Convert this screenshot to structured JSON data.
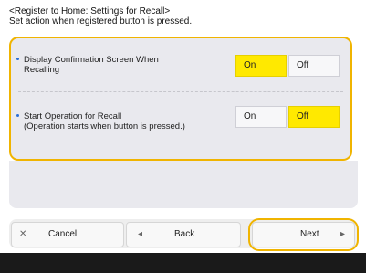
{
  "header": {
    "title": "<Register to Home: Settings for Recall>",
    "subtitle": "Set action when registered button is pressed."
  },
  "settings": [
    {
      "label_line1": "Display Confirmation Screen When",
      "label_line2": "Recalling",
      "options": [
        "On",
        "Off"
      ],
      "selected": "On"
    },
    {
      "label_line1": "Start Operation for Recall",
      "label_line2": "(Operation starts when button is pressed.)",
      "options": [
        "On",
        "Off"
      ],
      "selected": "Off"
    }
  ],
  "footer": {
    "cancel_label": "Cancel",
    "back_label": "Back",
    "next_label": "Next"
  },
  "icons": {
    "cancel": "close-icon",
    "back": "arrow-left-icon",
    "next": "arrow-right-icon"
  },
  "colors": {
    "accent_outline": "#f0b400",
    "selected_bg": "#ffe900",
    "panel_bg": "#e9e9ee"
  }
}
